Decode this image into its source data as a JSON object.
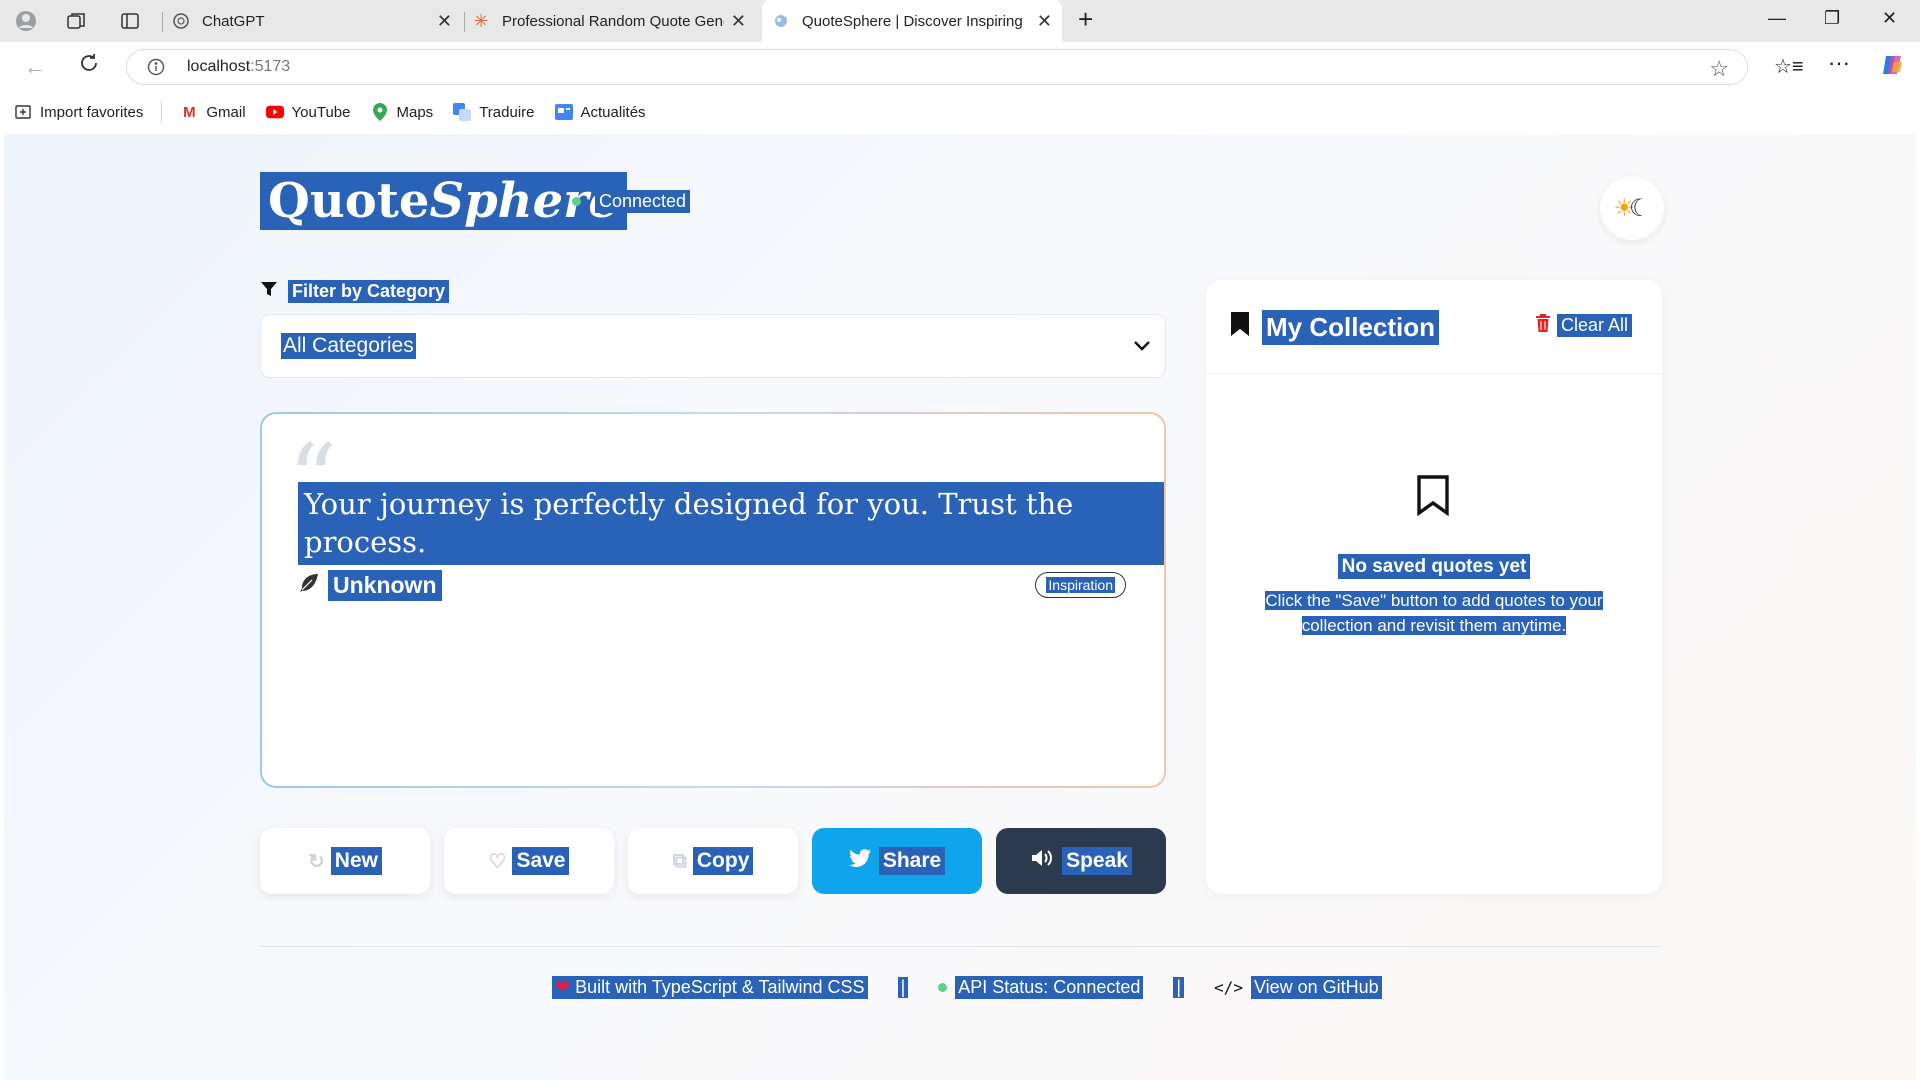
{
  "browser": {
    "tabs": [
      {
        "title": "ChatGPT",
        "active": false
      },
      {
        "title": "Professional Random Quote Gene",
        "active": false
      },
      {
        "title": "QuoteSphere | Discover Inspiring",
        "active": true
      }
    ],
    "url_host": "localhost",
    "url_port": ":5173",
    "bookmarks": [
      "Import favorites",
      "Gmail",
      "YouTube",
      "Maps",
      "Traduire",
      "Actualités"
    ]
  },
  "header": {
    "logo_part1": "Quote",
    "logo_part2": "Sphere",
    "status": "Connected"
  },
  "filter": {
    "label": "Filter by Category",
    "selected": "All Categories"
  },
  "quote": {
    "text": "Your journey is perfectly designed for you. Trust the process.",
    "author": "Unknown",
    "category": "Inspiration"
  },
  "actions": {
    "new": "New",
    "save": "Save",
    "copy": "Copy",
    "share": "Share",
    "speak": "Speak"
  },
  "collection": {
    "title": "My Collection",
    "clear_all": "Clear All",
    "empty_title": "No saved quotes yet",
    "empty_desc": "Click the \"Save\" button to add quotes to your collection and revisit them anytime."
  },
  "footer": {
    "built_with": "Built with TypeScript & Tailwind CSS",
    "api_status": "API Status: Connected",
    "github": "View on GitHub",
    "separator": "|"
  },
  "colors": {
    "selection": "#2a62b8",
    "share": "#0ea5ec",
    "speak": "#2c3a50",
    "connected_dot": "#5cd18c",
    "heart": "#e11d48",
    "trash": "#e02424"
  }
}
